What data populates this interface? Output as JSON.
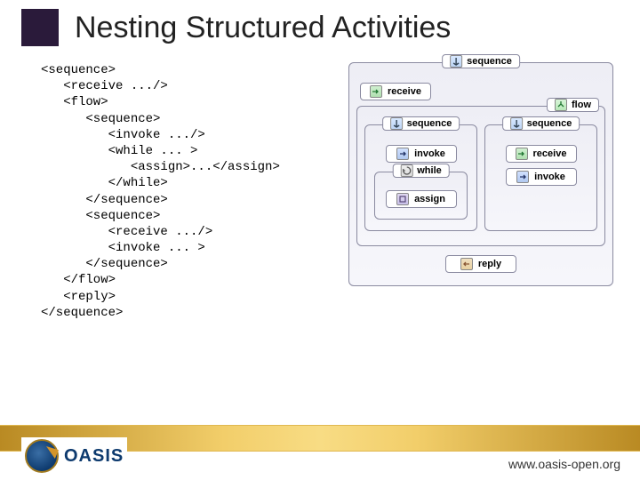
{
  "title": "Nesting Structured Activities",
  "code": "<sequence>\n   <receive .../>\n   <flow>\n      <sequence>\n         <invoke .../>\n         <while ... >\n            <assign>...</assign>\n         </while>\n      </sequence>\n      <sequence>\n         <receive .../>\n         <invoke ... >\n      </sequence>\n   </flow>\n   <reply>\n</sequence>",
  "diagram": {
    "sequence": "sequence",
    "receive": "receive",
    "flow": "flow",
    "seq1": "sequence",
    "invoke": "invoke",
    "while": "while",
    "assign": "assign",
    "seq2": "sequence",
    "receive2": "receive",
    "invoke2": "invoke",
    "reply": "reply"
  },
  "footer": {
    "logo_text": "OASIS",
    "url": "www.oasis-open.org"
  }
}
